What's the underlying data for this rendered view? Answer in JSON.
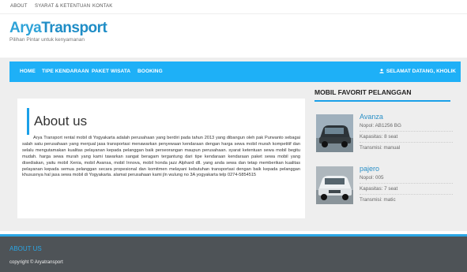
{
  "topnav": {
    "about": "ABOUT",
    "terms": "SYARAT & KETENTUAN",
    "contact": "KONTAK"
  },
  "brand": {
    "part1": "Arya",
    "part2": "Transport",
    "tagline": "Pilihan Pintar untuk kenyamanan"
  },
  "colors": {
    "accent": "#1eb0f7",
    "brand": "#2fa3d8",
    "footer_bg": "#4e5357",
    "page_bg": "#eeeeee"
  },
  "menu": {
    "home": "HOME",
    "vehicle_types": "TIPE KENDARAAN",
    "tour_packages": "PAKET WISATA",
    "booking": "BOOKING",
    "user_greeting": "SELAMAT DATANG, KHOLIK",
    "user_icon": "user-icon"
  },
  "about": {
    "title": "About us",
    "body": "Arya Transport rental mobil di Yogyakarta adalah perusahaan yang berdiri pada tahun 2013 yang dibangun oleh pak Purwanto sebagai salah satu perusahaan yang menjual jasa transportasi menawarkan penyewaan kendaraan dengan harga sewa mobil murah kompetitif dan selalu mengutamakan kualitas pelayanan kepada pelanggan baik perseorangan maupun perusahaan. syarat ketentuan sewa mobil begitu mudah. harga sewa murah yang kami tawarkan sangat beragam tergantung dari tipe kendaraan kendaraan paket sewa mobil yang disediakan, yaitu mobil Xenia, mobil Avansa, mobil Innova, mobil honda jazz Alphard dll. yang anda sewa dan tetap memberikan kualitas pelayanan kepada semua pelanggan secara propesional dan komitmen melayani kebutuhan transportasi dengan baik kepada pelanggan khususnya hal jasa sewa mobil di Yogyakarta. alamat perusahaan kami jln wulung no 3A yogyakarta telp 0274-5854515"
  },
  "sidebar": {
    "title": "MOBIL FAVORIT PELANGGAN",
    "cars": [
      {
        "name": "Avanza",
        "plate": "Nopol: AB1256 BG",
        "capacity": "Kapasitas: 8 seat",
        "transmission": "Transmisi: manual"
      },
      {
        "name": "pajero",
        "plate": "Nopol: 005",
        "capacity": "Kapasitas: 7 seat",
        "transmission": "Transmisi: matic"
      }
    ]
  },
  "footer": {
    "title": "ABOUT US",
    "copyright": "copyright © Aryatransport"
  }
}
